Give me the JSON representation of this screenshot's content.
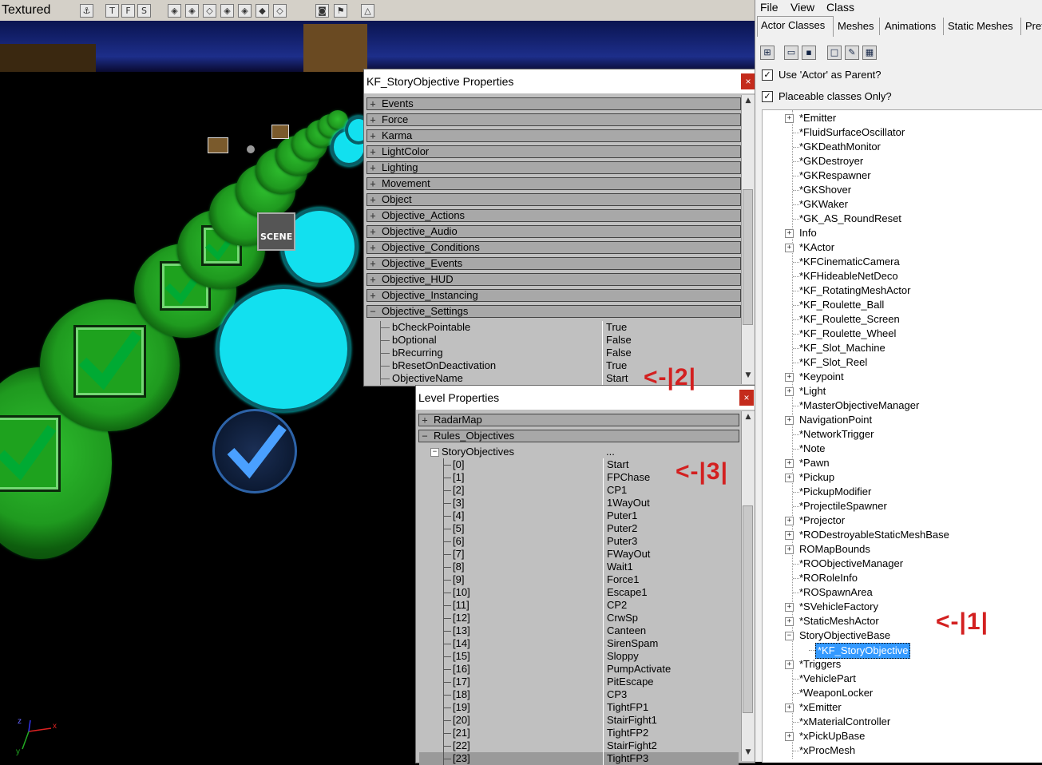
{
  "viewport": {
    "mode": "Textured",
    "toolbar_icons": [
      "actor-icon",
      "texture-t-icon",
      "texture-f-icon",
      "texture-s-icon",
      "cube-icon",
      "cube-icon",
      "cube-icon",
      "cube-icon",
      "cube-icon",
      "cube-icon",
      "cube-icon",
      "camera-icon",
      "flag-icon",
      "terrain-icon"
    ],
    "toolbar_glyphs": [
      "⚓",
      "T",
      "F",
      "S",
      "◈",
      "◈",
      "◇",
      "◈",
      "◈",
      "◆",
      "◇",
      "◙",
      "⚑",
      "△"
    ],
    "scene_label": "SCENE",
    "axes": {
      "x": "x",
      "y": "y",
      "z": "z"
    }
  },
  "story_props": {
    "title": "KF_StoryObjective Properties",
    "close": "×",
    "categories": [
      {
        "sign": "+",
        "label": "Events"
      },
      {
        "sign": "+",
        "label": "Force"
      },
      {
        "sign": "+",
        "label": "Karma"
      },
      {
        "sign": "+",
        "label": "LightColor"
      },
      {
        "sign": "+",
        "label": "Lighting"
      },
      {
        "sign": "+",
        "label": "Movement"
      },
      {
        "sign": "+",
        "label": "Object"
      },
      {
        "sign": "+",
        "label": "Objective_Actions"
      },
      {
        "sign": "+",
        "label": "Objective_Audio"
      },
      {
        "sign": "+",
        "label": "Objective_Conditions"
      },
      {
        "sign": "+",
        "label": "Objective_Events"
      },
      {
        "sign": "+",
        "label": "Objective_HUD"
      },
      {
        "sign": "+",
        "label": "Objective_Instancing"
      },
      {
        "sign": "−",
        "label": "Objective_Settings"
      }
    ],
    "props": [
      {
        "name": "bCheckPointable",
        "value": "True"
      },
      {
        "name": "bOptional",
        "value": "False"
      },
      {
        "name": "bRecurring",
        "value": "False"
      },
      {
        "name": "bResetOnDeactivation",
        "value": "True"
      },
      {
        "name": "ObjectiveName",
        "value": "Start"
      }
    ],
    "annotation": "<-|2|"
  },
  "level_props": {
    "title": "Level Properties",
    "close": "×",
    "categories": [
      {
        "sign": "+",
        "label": "RadarMap"
      },
      {
        "sign": "−",
        "label": "Rules_Objectives"
      }
    ],
    "story_node": {
      "sign": "−",
      "label": "StoryObjectives",
      "value": "..."
    },
    "objectives": [
      {
        "index": "[0]",
        "value": "Start"
      },
      {
        "index": "[1]",
        "value": "FPChase"
      },
      {
        "index": "[2]",
        "value": "CP1"
      },
      {
        "index": "[3]",
        "value": "1WayOut"
      },
      {
        "index": "[4]",
        "value": "Puter1"
      },
      {
        "index": "[5]",
        "value": "Puter2"
      },
      {
        "index": "[6]",
        "value": "Puter3"
      },
      {
        "index": "[7]",
        "value": "FWayOut"
      },
      {
        "index": "[8]",
        "value": "Wait1"
      },
      {
        "index": "[9]",
        "value": "Force1"
      },
      {
        "index": "[10]",
        "value": "Escape1"
      },
      {
        "index": "[11]",
        "value": "CP2"
      },
      {
        "index": "[12]",
        "value": "CrwSp"
      },
      {
        "index": "[13]",
        "value": "Canteen"
      },
      {
        "index": "[14]",
        "value": "SirenSpam"
      },
      {
        "index": "[15]",
        "value": "Sloppy"
      },
      {
        "index": "[16]",
        "value": "PumpActivate"
      },
      {
        "index": "[17]",
        "value": "PitEscape"
      },
      {
        "index": "[18]",
        "value": "CP3"
      },
      {
        "index": "[19]",
        "value": "TightFP1"
      },
      {
        "index": "[20]",
        "value": "StairFight1"
      },
      {
        "index": "[21]",
        "value": "TightFP2"
      },
      {
        "index": "[22]",
        "value": "StairFight2"
      },
      {
        "index": "[23]",
        "value": "TightFP3"
      }
    ],
    "annotation": "<-|3|"
  },
  "browser": {
    "menu": [
      "File",
      "View",
      "Class"
    ],
    "tabs": [
      "Actor Classes",
      "Meshes",
      "Animations",
      "Static Meshes",
      "Pref"
    ],
    "toolbar_icons": [
      "class-tree-icon",
      "open-folder-icon",
      "save-icon",
      "new-doc-icon",
      "edit-pencil-icon",
      "properties-icon"
    ],
    "toolbar_glyphs": [
      "⊞",
      "▭",
      "▪",
      "□",
      "✎",
      "▦"
    ],
    "options": [
      {
        "label": "Use 'Actor' as Parent?",
        "checked": true
      },
      {
        "label": "Placeable classes Only?",
        "checked": true
      }
    ],
    "tree": [
      {
        "label": "*Emitter",
        "exp": "+",
        "level": 0
      },
      {
        "label": "*FluidSurfaceOscillator",
        "exp": "",
        "level": 0
      },
      {
        "label": "*GKDeathMonitor",
        "exp": "",
        "level": 0
      },
      {
        "label": "*GKDestroyer",
        "exp": "",
        "level": 0
      },
      {
        "label": "*GKRespawner",
        "exp": "",
        "level": 0
      },
      {
        "label": "*GKShover",
        "exp": "",
        "level": 0
      },
      {
        "label": "*GKWaker",
        "exp": "",
        "level": 0
      },
      {
        "label": "*GK_AS_RoundReset",
        "exp": "",
        "level": 0
      },
      {
        "label": "Info",
        "exp": "+",
        "level": 0
      },
      {
        "label": "*KActor",
        "exp": "+",
        "level": 0
      },
      {
        "label": "*KFCinematicCamera",
        "exp": "",
        "level": 0
      },
      {
        "label": "*KFHideableNetDeco",
        "exp": "",
        "level": 0
      },
      {
        "label": "*KF_RotatingMeshActor",
        "exp": "",
        "level": 0
      },
      {
        "label": "*KF_Roulette_Ball",
        "exp": "",
        "level": 0
      },
      {
        "label": "*KF_Roulette_Screen",
        "exp": "",
        "level": 0
      },
      {
        "label": "*KF_Roulette_Wheel",
        "exp": "",
        "level": 0
      },
      {
        "label": "*KF_Slot_Machine",
        "exp": "",
        "level": 0
      },
      {
        "label": "*KF_Slot_Reel",
        "exp": "",
        "level": 0
      },
      {
        "label": "*Keypoint",
        "exp": "+",
        "level": 0
      },
      {
        "label": "*Light",
        "exp": "+",
        "level": 0
      },
      {
        "label": "*MasterObjectiveManager",
        "exp": "",
        "level": 0
      },
      {
        "label": "NavigationPoint",
        "exp": "+",
        "level": 0
      },
      {
        "label": "*NetworkTrigger",
        "exp": "",
        "level": 0
      },
      {
        "label": "*Note",
        "exp": "",
        "level": 0
      },
      {
        "label": "*Pawn",
        "exp": "+",
        "level": 0
      },
      {
        "label": "*Pickup",
        "exp": "+",
        "level": 0
      },
      {
        "label": "*PickupModifier",
        "exp": "",
        "level": 0
      },
      {
        "label": "*ProjectileSpawner",
        "exp": "",
        "level": 0
      },
      {
        "label": "*Projector",
        "exp": "+",
        "level": 0
      },
      {
        "label": "*RODestroyableStaticMeshBase",
        "exp": "+",
        "level": 0
      },
      {
        "label": "ROMapBounds",
        "exp": "+",
        "level": 0
      },
      {
        "label": "*ROObjectiveManager",
        "exp": "",
        "level": 0
      },
      {
        "label": "*RORoleInfo",
        "exp": "",
        "level": 0
      },
      {
        "label": "*ROSpawnArea",
        "exp": "",
        "level": 0
      },
      {
        "label": "*SVehicleFactory",
        "exp": "+",
        "level": 0
      },
      {
        "label": "*StaticMeshActor",
        "exp": "+",
        "level": 0
      },
      {
        "label": "StoryObjectiveBase",
        "exp": "−",
        "level": 0
      },
      {
        "label": "*KF_StoryObjective",
        "exp": "",
        "level": 1,
        "selected": true
      },
      {
        "label": "*Triggers",
        "exp": "+",
        "level": 0
      },
      {
        "label": "*VehiclePart",
        "exp": "",
        "level": 0
      },
      {
        "label": "*WeaponLocker",
        "exp": "",
        "level": 0
      },
      {
        "label": "*xEmitter",
        "exp": "+",
        "level": 0
      },
      {
        "label": "*xMaterialController",
        "exp": "",
        "level": 0
      },
      {
        "label": "*xPickUpBase",
        "exp": "+",
        "level": 0
      },
      {
        "label": "*xProcMesh",
        "exp": "",
        "level": 0
      }
    ],
    "annotation": "<-|1|"
  },
  "colors": {
    "close": "#c42b1c",
    "selection": "#3399ff",
    "annotation": "#d32020",
    "objective_green": "#1f9a1f",
    "objective_cyan": "#12e0ef"
  }
}
